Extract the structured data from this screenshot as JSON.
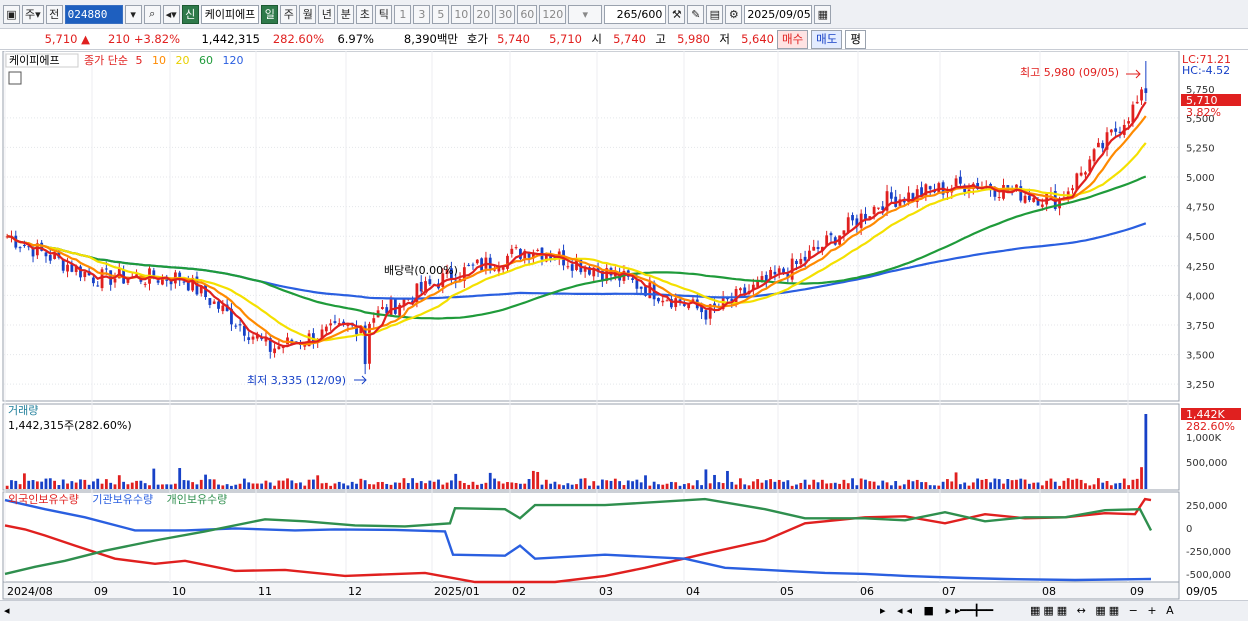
{
  "toolbar": {
    "market": "주",
    "prev": "전",
    "code": "024880",
    "new_label": "신",
    "stock_name": "케이피에프",
    "periods": [
      "일",
      "주",
      "월",
      "년",
      "분",
      "초",
      "틱"
    ],
    "minutes": [
      "1",
      "3",
      "5",
      "10",
      "20",
      "30",
      "60",
      "120"
    ],
    "count": "265",
    "count_max": "/600",
    "date": "2025/09/05"
  },
  "quote": {
    "price": "5,710",
    "change": "210",
    "change_pct": "+3.82%",
    "volume": "1,442,315",
    "volume_pct": "282.60%",
    "turnover": "6.97%",
    "amount": "8,390백만",
    "ask_label": "호가",
    "ask": "5,740",
    "bid": "5,710",
    "open_label": "시",
    "open": "5,740",
    "high_label": "고",
    "high": "5,980",
    "low_label": "저",
    "low": "5,640",
    "buy": "매수",
    "sell": "매도",
    "eval": "평"
  },
  "price_panel": {
    "name": "케이피에프",
    "ma_label": "종가 단순",
    "ma_periods": [
      "5",
      "10",
      "20",
      "60",
      "120"
    ],
    "lc": "LC:71.21",
    "hc": "HC:-4.52",
    "current_tag": "5,710",
    "current_pct": "3.82%",
    "top_tag": "5,750",
    "high_note": "최고 5,980 (09/05)",
    "low_note": "최저 3,335 (12/09)",
    "dividend_note": "배당락(0.00%)"
  },
  "volume_panel": {
    "title": "거래량",
    "summary": "1,442,315주(282.60%)",
    "tag": "1,442K",
    "tag_pct": "282.60%",
    "axis": [
      "1,000K",
      "500,000"
    ]
  },
  "flow_panel": {
    "legend": [
      "외국인보유수량",
      "기관보유수량",
      "개인보유수량"
    ],
    "axis": [
      "250,000",
      "0",
      "-250,000",
      "-500,000"
    ]
  },
  "x_axis": [
    "2024/08",
    "09",
    "10",
    "11",
    "12",
    "2025/01",
    "02",
    "03",
    "04",
    "05",
    "06",
    "07",
    "08",
    "09",
    "09/05"
  ],
  "colors": {
    "up": "#e0201f",
    "down": "#1741c7",
    "ma5": "#e0201f",
    "ma10": "#ff8a00",
    "ma20": "#f4e000",
    "ma60": "#1f9b3a",
    "ma120": "#2a5fe0",
    "foreign": "#e0201f",
    "inst": "#2a5fe0",
    "indiv": "#2f8f4e"
  },
  "chart_data": {
    "type": "candlestick",
    "y_ticks": [
      5500,
      5250,
      5000,
      4750,
      4500,
      4250,
      4000,
      3750,
      3500,
      3250
    ],
    "ylim": [
      3150,
      5980
    ],
    "monthly_closes": [
      {
        "month": "2024/08",
        "value": 4500
      },
      {
        "month": "09",
        "value": 4150
      },
      {
        "month": "10",
        "value": 4150
      },
      {
        "month": "11",
        "value": 3550
      },
      {
        "month": "12",
        "value": 3750
      },
      {
        "month": "2025/01",
        "value": 4150
      },
      {
        "month": "02",
        "value": 4400
      },
      {
        "month": "03",
        "value": 4150
      },
      {
        "month": "04",
        "value": 3850
      },
      {
        "month": "05",
        "value": 4250
      },
      {
        "month": "06",
        "value": 4800
      },
      {
        "month": "07",
        "value": 4950
      },
      {
        "month": "08",
        "value": 4800
      },
      {
        "month": "09",
        "value": 5710
      }
    ],
    "high": {
      "value": 5980,
      "date": "09/05"
    },
    "low": {
      "value": 3335,
      "date": "12/09"
    },
    "last_volume": 1442315,
    "flow_y_ticks": [
      250000,
      0,
      -250000,
      -500000
    ]
  }
}
